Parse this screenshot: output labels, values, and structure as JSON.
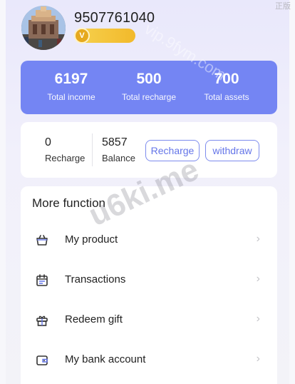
{
  "profile": {
    "phone": "9507761040",
    "vip_mark": "V"
  },
  "stats": {
    "total_income_value": "6197",
    "total_income_label": "Total income",
    "total_recharge_value": "500",
    "total_recharge_label": "Total recharge",
    "total_assets_value": "700",
    "total_assets_label": "Total assets"
  },
  "wallet": {
    "recharge_value": "0",
    "recharge_label": "Recharge",
    "balance_value": "5857",
    "balance_label": "Balance",
    "recharge_button": "Recharge",
    "withdraw_button": "withdraw"
  },
  "menu": {
    "title": "More function",
    "items": [
      {
        "label": "My product",
        "icon": "basket-icon"
      },
      {
        "label": "Transactions",
        "icon": "calendar-icon"
      },
      {
        "label": "Redeem gift",
        "icon": "gift-icon"
      },
      {
        "label": "My bank account",
        "icon": "wallet-icon"
      }
    ],
    "chevron": "›"
  },
  "overlay": {
    "watermark_main": "u6ki.me",
    "watermark_faint": "vip.9fym.com",
    "corner_text": "正版"
  },
  "colors": {
    "accent": "#7485f3",
    "button_border": "#7d8cee",
    "button_text": "#6475e8",
    "vip_gold": "#f2b92b"
  }
}
